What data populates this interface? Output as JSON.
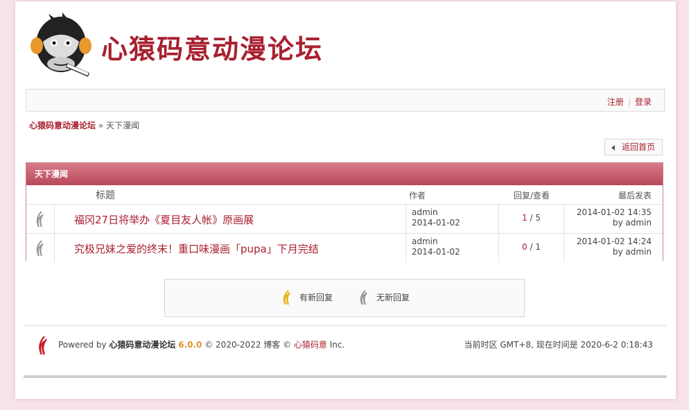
{
  "site": {
    "name": "心猿码意动漫论坛"
  },
  "userbar": {
    "register": "注册",
    "login": "登录"
  },
  "breadcrumb": {
    "home": "心猿码意动漫论坛",
    "sep": "»",
    "current": "天下漫闻"
  },
  "back_button": {
    "label": "返回首页"
  },
  "forum": {
    "name": "天下漫闻",
    "columns": {
      "title": "标题",
      "author": "作者",
      "stats": "回复/查看",
      "last": "最后发表"
    },
    "threads": [
      {
        "title": "福冈27日将举办《夏目友人帐》原画展",
        "author": "admin",
        "date": "2014-01-02",
        "replies": "1",
        "views": "5",
        "last_time": "2014-01-02 14:35",
        "last_by": "by admin"
      },
      {
        "title": "究极兄妹之爱的终末！重口味漫画「pupa」下月完结",
        "author": "admin",
        "date": "2014-01-02",
        "replies": "0",
        "views": "1",
        "last_time": "2014-01-02 14:24",
        "last_by": "by admin"
      }
    ]
  },
  "legend": {
    "new_reply": "有新回复",
    "no_new_reply": "无新回复"
  },
  "footer": {
    "powered_by": "Powered by",
    "product": "心猿码意动漫论坛",
    "version": "6.0.0",
    "copyright_pre": "© 2020-2022 博客 ©",
    "brand": "心猿码意",
    "copyright_post": "Inc.",
    "timezone": "当前时区 GMT+8, 现在时间是 2020-6-2 0:18:43"
  },
  "colors": {
    "accent": "#a8202f",
    "header_top": "#d97c8b",
    "header_bottom": "#b8485a",
    "page_bg": "#f7e3e8"
  },
  "icons": {
    "logo": "gorilla-logo-icon",
    "new": "flame-new-icon",
    "old": "flame-old-icon",
    "back": "triangle-left-icon"
  }
}
